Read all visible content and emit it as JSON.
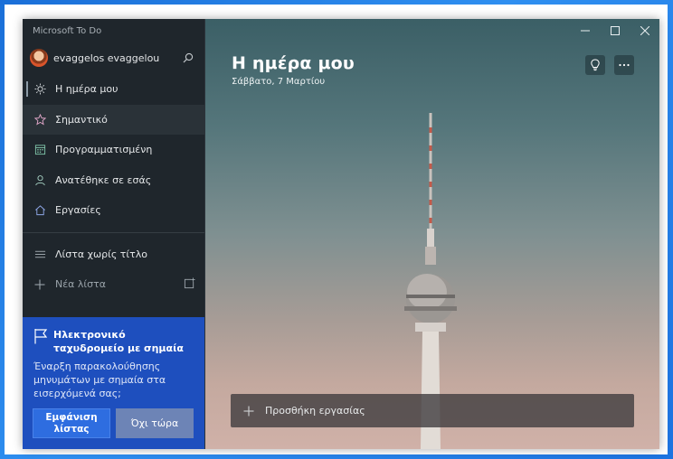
{
  "app": {
    "title": "Microsoft To Do"
  },
  "account": {
    "name": "evaggelos evaggelou"
  },
  "sidebar": {
    "items": [
      {
        "label": "Η ημέρα μου",
        "icon": "sun-icon"
      },
      {
        "label": "Σημαντικό",
        "icon": "star-icon"
      },
      {
        "label": "Προγραμματισμένη",
        "icon": "calendar-icon"
      },
      {
        "label": "Ανατέθηκε σε εσάς",
        "icon": "person-icon"
      },
      {
        "label": "Εργασίες",
        "icon": "home-icon"
      }
    ],
    "lists": [
      {
        "label": "Λίστα χωρίς τίτλο",
        "icon": "list-icon"
      }
    ],
    "new_list": {
      "label": "Νέα λίστα"
    }
  },
  "promo": {
    "title": "Ηλεκτρονικό ταχυδρομείο με σημαία",
    "text": "Έναρξη παρακολούθησης μηνυμάτων με σημαία στα εισερχόμενά σας;",
    "primary_label": "Εμφάνιση λίστας",
    "secondary_label": "Όχι τώρα"
  },
  "main": {
    "title": "Η ημέρα μου",
    "date": "Σάββατο, 7 Μαρτίου",
    "add_task_label": "Προσθήκη εργασίας"
  },
  "colors": {
    "sidebar_bg": "#1f262c",
    "promo_bg": "#1e4fbe",
    "primary_button": "#2e6de0",
    "desktop_bg": "#1a6fd8"
  }
}
